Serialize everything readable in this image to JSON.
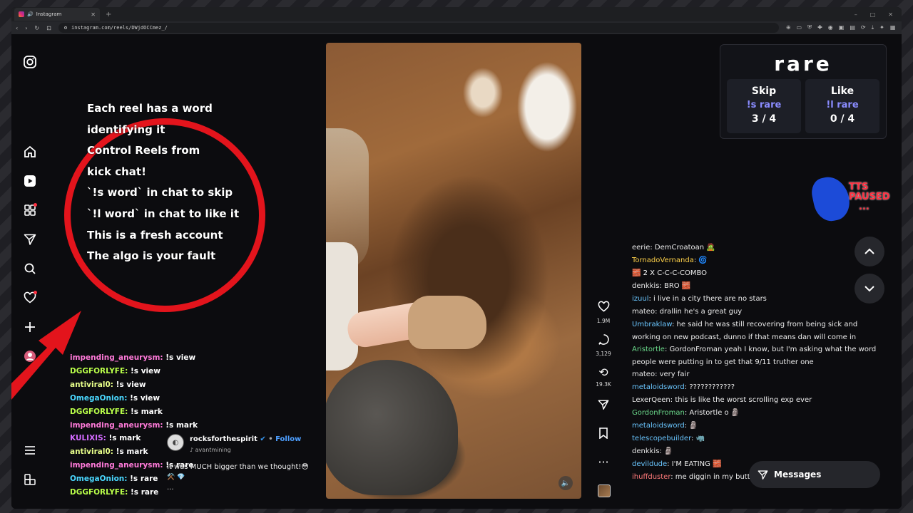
{
  "browser": {
    "tab_title": "Instagram",
    "new_tab": "+",
    "url": "instagram.com/reels/DWjdOCCmez_/",
    "window_controls": [
      "–",
      "□",
      "✕"
    ]
  },
  "overlay": {
    "lines": [
      "Each reel has a word",
      "identifying it",
      "Control Reels from",
      "kick chat!",
      "`!s word` in chat to skip",
      "`!l word` in chat to like it",
      "This is a fresh account",
      "The algo is your fault"
    ]
  },
  "left_chat": [
    {
      "user": "impending_aneurysm:",
      "text": "!s view",
      "color": "#ff7ad9"
    },
    {
      "user": "DGGFORLYFE:",
      "text": "!s view",
      "color": "#baff4a"
    },
    {
      "user": "antiviral0:",
      "text": "!s view",
      "color": "#e8ff8a"
    },
    {
      "user": "OmegaOnion:",
      "text": "!s view",
      "color": "#4ad8ff"
    },
    {
      "user": "DGGFORLYFE:",
      "text": "!s mark",
      "color": "#baff4a"
    },
    {
      "user": "impending_aneurysm:",
      "text": "!s mark",
      "color": "#ff7ad9"
    },
    {
      "user": "KULIXIS:",
      "text": "!s mark",
      "color": "#d46bff"
    },
    {
      "user": "antiviral0:",
      "text": "!s mark",
      "color": "#e8ff8a"
    },
    {
      "user": "impending_aneurysm:",
      "text": "!s rare",
      "color": "#ff7ad9"
    },
    {
      "user": "OmegaOnion:",
      "text": "!s rare",
      "color": "#4ad8ff"
    },
    {
      "user": "DGGFORLYFE:",
      "text": "!s rare",
      "color": "#baff4a"
    }
  ],
  "post": {
    "username": "rocksforthespirit",
    "follow": "Follow",
    "audio": "avantmining",
    "caption": "It was MUCH bigger than we thought!😳",
    "caption2": "⚒️ 💎",
    "more": "..."
  },
  "actions": {
    "likes": "1.9M",
    "comments": "3,129",
    "reposts": "19.3K"
  },
  "vote_panel": {
    "word": "rare",
    "skip": {
      "label": "Skip",
      "command": "!s rare",
      "count": "3 / 4"
    },
    "like": {
      "label": "Like",
      "command": "!l rare",
      "count": "0 / 4"
    }
  },
  "tts": {
    "line1": "TTS",
    "line2": "PAUSED",
    "line3": "..."
  },
  "right_chat": [
    {
      "user": "eerie",
      "text": ": DemCroatoan 🧟",
      "color": "#e8e8e8"
    },
    {
      "user": "TornadoVernanda",
      "text": ":  🌀",
      "color": "#ffd24a"
    },
    {
      "user": "🧱 2 X",
      "text": " C-C-C-COMBO",
      "color": "#ffffff"
    },
    {
      "user": "denkkis",
      "text": ": BRO 🧱",
      "color": "#e8e8e8"
    },
    {
      "user": "izuul",
      "text": ": i live in a city there are no stars",
      "color": "#6ac6ff"
    },
    {
      "user": "mateo",
      "text": ": drallin he's a great guy",
      "color": "#e8e8e8"
    },
    {
      "user": "Umbraklaw",
      "text": ": he said he was still recovering from being sick and working on new podcast, dunno if that means dan will come in",
      "color": "#6ac6ff",
      "wrap": true
    },
    {
      "user": "Aristortle",
      "text": ": GordonFroman yeah I know, but I'm asking what the word people were putting in to get that 9/11 truther one",
      "color": "#6ad88a",
      "wrap": true
    },
    {
      "user": "mateo",
      "text": ": very fair",
      "color": "#e8e8e8"
    },
    {
      "user": "metaloidsword",
      "text": ": ????????????",
      "color": "#6ac6ff"
    },
    {
      "user": "LexerQeen",
      "text": ": this is like the worst scrolling exp ever",
      "color": "#e8e8e8"
    },
    {
      "user": "GordonFroman",
      "text": ": Aristortle o 🗿",
      "color": "#6ad88a"
    },
    {
      "user": "metaloidsword",
      "text": ": 🗿",
      "color": "#6ac6ff"
    },
    {
      "user": "telescopebuilder",
      "text": ": 🦏",
      "color": "#6ac6ff"
    },
    {
      "user": "denkkis",
      "text": ": 🗿",
      "color": "#e8e8e8"
    },
    {
      "user": "devildude",
      "text": ": I'M EATING 🧱",
      "color": "#6ac6ff"
    },
    {
      "user": "ihuffduster",
      "text": ": me diggin in my butt",
      "color": "#ff7a7a"
    }
  ],
  "messages": {
    "label": "Messages"
  }
}
